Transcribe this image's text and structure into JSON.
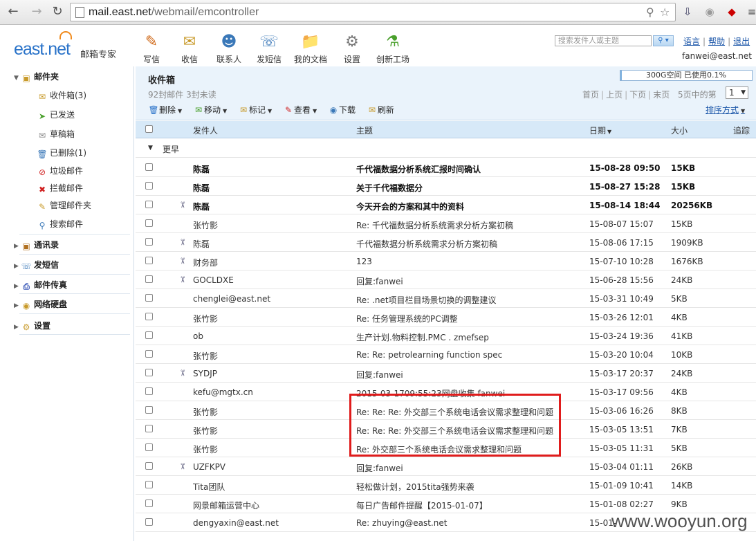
{
  "browser": {
    "url_host": "mail.east.net",
    "url_path": "/webmail/emcontroller"
  },
  "header": {
    "logo": "east.net",
    "logo_sub": "邮箱专家",
    "tools": [
      {
        "label": "写信",
        "icon": "pencil-icon"
      },
      {
        "label": "收信",
        "icon": "envelope-icon"
      },
      {
        "label": "联系人",
        "icon": "contacts-icon"
      },
      {
        "label": "发短信",
        "icon": "phone-icon"
      },
      {
        "label": "我的文档",
        "icon": "folder-icon"
      },
      {
        "label": "设置",
        "icon": "gear-icon"
      },
      {
        "label": "创新工场",
        "icon": "flask-icon"
      }
    ],
    "search_placeholder": "搜索发件人或主题",
    "links": [
      "语言",
      "帮助",
      "退出"
    ],
    "user_email": "fanwei@east.net"
  },
  "sidebar": {
    "folder_head": "邮件夹",
    "items": [
      {
        "label": "收件箱(3)",
        "icon": "inbox-icon"
      },
      {
        "label": "已发送",
        "icon": "sent-icon"
      },
      {
        "label": "草稿箱",
        "icon": "draft-icon"
      },
      {
        "label": "已删除(1)",
        "icon": "trash-icon"
      },
      {
        "label": "垃圾邮件",
        "icon": "spam-icon"
      },
      {
        "label": "拦截邮件",
        "icon": "blocked-icon"
      },
      {
        "label": "管理邮件夹",
        "icon": "manage-folder-icon"
      },
      {
        "label": "搜索邮件",
        "icon": "search-icon"
      }
    ],
    "groups": [
      {
        "label": "通讯录",
        "icon": "address-book-icon"
      },
      {
        "label": "发短信",
        "icon": "sms-icon"
      },
      {
        "label": "邮件传真",
        "icon": "fax-icon"
      },
      {
        "label": "网络硬盘",
        "icon": "disk-icon"
      },
      {
        "label": "设置",
        "icon": "settings-icon"
      }
    ]
  },
  "main": {
    "title": "收件箱",
    "count": "92封邮件 3封未读",
    "quota": "300G空间 已使用0.1%",
    "quota_used_fraction": 0.001,
    "pager": [
      "首页",
      "上页",
      "下页",
      "末页",
      "5页中的第"
    ],
    "page_value": "1",
    "actions": [
      {
        "label": "删除",
        "caret": true
      },
      {
        "label": "移动",
        "caret": true
      },
      {
        "label": "标记",
        "caret": true
      },
      {
        "label": "查看",
        "caret": true
      },
      {
        "label": "下载",
        "caret": false
      },
      {
        "label": "刷新",
        "caret": false
      }
    ],
    "sort_label": "排序方式",
    "columns": {
      "sender": "发件人",
      "subject": "主题",
      "date": "日期",
      "size": "大小",
      "track": "追踪"
    },
    "group_label": "更早",
    "rows": [
      {
        "sender": "陈磊",
        "subject": "千代福数据分析系统汇报时间确认",
        "date": "15-08-28 09:50",
        "size": "15KB",
        "unread": true,
        "attach": false
      },
      {
        "sender": "陈磊",
        "subject": "关于千代福数据分",
        "date": "15-08-27 15:28",
        "size": "15KB",
        "unread": true,
        "attach": false
      },
      {
        "sender": "陈磊",
        "subject": "今天开会的方案和其中的资料",
        "date": "15-08-14 18:44",
        "size": "20256KB",
        "unread": true,
        "attach": true
      },
      {
        "sender": "张竹影",
        "subject": "Re: 千代福数据分析系统需求分析方案初稿",
        "date": "15-08-07 15:07",
        "size": "15KB",
        "unread": false,
        "attach": false
      },
      {
        "sender": "陈磊",
        "subject": "千代福数据分析系统需求分析方案初稿",
        "date": "15-08-06 17:15",
        "size": "1909KB",
        "unread": false,
        "attach": true
      },
      {
        "sender": "财务部",
        "subject": "123",
        "date": "15-07-10 10:28",
        "size": "1676KB",
        "unread": false,
        "attach": true
      },
      {
        "sender": "GOCLDXE",
        "subject": "回复:fanwei",
        "date": "15-06-28 15:56",
        "size": "24KB",
        "unread": false,
        "attach": true
      },
      {
        "sender": "chenglei@east.net",
        "subject": "Re: .net项目栏目场景切换的调整建议",
        "date": "15-03-31 10:49",
        "size": "5KB",
        "unread": false,
        "attach": false
      },
      {
        "sender": "张竹影",
        "subject": "Re: 任务管理系统的PC调整",
        "date": "15-03-26 12:01",
        "size": "4KB",
        "unread": false,
        "attach": false
      },
      {
        "sender": "ob",
        "subject": "生产计划.物料控制.PMC . zmefsep",
        "date": "15-03-24 19:36",
        "size": "41KB",
        "unread": false,
        "attach": false
      },
      {
        "sender": "张竹影",
        "subject": "Re: Re: petrolearning function spec",
        "date": "15-03-20 10:04",
        "size": "10KB",
        "unread": false,
        "attach": false
      },
      {
        "sender": "SYDJP",
        "subject": "回复:fanwei",
        "date": "15-03-17 20:37",
        "size": "24KB",
        "unread": false,
        "attach": true
      },
      {
        "sender": "kefu@mgtx.cn",
        "subject": "2015-03-1709:55:23网盘收集 fanwei",
        "date": "15-03-17 09:56",
        "size": "4KB",
        "unread": false,
        "attach": false
      },
      {
        "sender": "张竹影",
        "subject": "Re: Re: Re: 外交部三个系统电话会议需求整理和问题",
        "date": "15-03-06 16:26",
        "size": "8KB",
        "unread": false,
        "attach": false
      },
      {
        "sender": "张竹影",
        "subject": "Re: Re: Re: 外交部三个系统电话会议需求整理和问题",
        "date": "15-03-05 13:51",
        "size": "7KB",
        "unread": false,
        "attach": false
      },
      {
        "sender": "张竹影",
        "subject": "Re: 外交部三个系统电话会议需求整理和问题",
        "date": "15-03-05 11:31",
        "size": "5KB",
        "unread": false,
        "attach": false
      },
      {
        "sender": "UZFKPV",
        "subject": "回复:fanwei",
        "date": "15-03-04 01:11",
        "size": "26KB",
        "unread": false,
        "attach": true
      },
      {
        "sender": "Tita团队",
        "subject": "轻松做计划，2015tita强势来袭",
        "date": "15-01-09 10:41",
        "size": "14KB",
        "unread": false,
        "attach": false
      },
      {
        "sender": "网景邮箱运营中心",
        "subject": "每日广告邮件提醒【2015-01-07】",
        "date": "15-01-08 02:27",
        "size": "9KB",
        "unread": false,
        "attach": false
      },
      {
        "sender": "dengyaxin@east.net",
        "subject": "Re: zhuying@east.net",
        "date": "15-01-",
        "size": "",
        "unread": false,
        "attach": false
      }
    ]
  },
  "watermark": "www.wooyun.org"
}
